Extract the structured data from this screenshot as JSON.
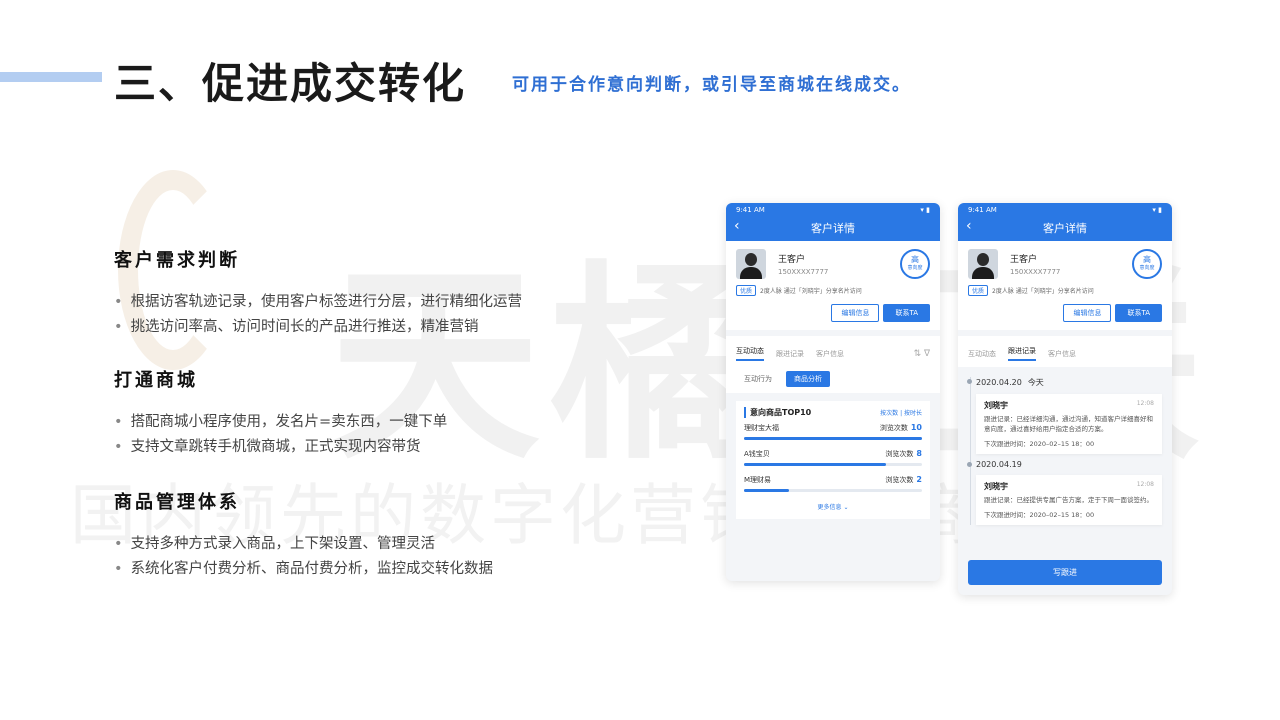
{
  "header": {
    "title": "三、促进成交转化",
    "subtitle": "可用于合作意向判断，或引导至商城在线成交。"
  },
  "watermark": {
    "big": "天橘互联",
    "line": "国内领先的数字化营销服务商"
  },
  "sections": [
    {
      "title": "客户需求判断",
      "bullets": [
        "根据访客轨迹记录，使用客户标签进行分层，进行精细化运营",
        "挑选访问率高、访问时间长的产品进行推送，精准营销"
      ]
    },
    {
      "title": "打通商城",
      "bullets": [
        "搭配商城小程序使用，发名片=卖东西，一键下单",
        "支持文章跳转手机微商城，正式实现内容带货"
      ]
    },
    {
      "title": "商品管理体系",
      "bullets": [
        "支持多种方式录入商品，上下架设置、管理灵活",
        "系统化客户付费分析、商品付费分析，监控成交转化数据"
      ]
    }
  ],
  "phone_a": {
    "status_time": "9:41 AM",
    "status_icons": "▾ ▮",
    "nav_title": "客户详情",
    "back_icon": "‹",
    "customer": {
      "name": "王客户",
      "phone": "150XXXX7777",
      "level": "高",
      "level_sub": "意向度",
      "tag": "优质",
      "source": "2度人脉  通过「刘晓宇」分享名片访问",
      "edit_label": "编辑信息",
      "contact_label": "联系TA"
    },
    "tabs": [
      "互动动态",
      "跟进记录",
      "客户信息"
    ],
    "tab_tools": "⇅  ∇",
    "segments": [
      "互动行为",
      "商品分析"
    ],
    "top": {
      "title": "意向商品TOP10",
      "sort": "按次数 | 按时长",
      "count_label": "浏览次数",
      "products": [
        {
          "name": "理财宝大福",
          "count": "10",
          "fill": 1.0
        },
        {
          "name": "A钱宝贝",
          "count": "8",
          "fill": 0.8
        },
        {
          "name": "M理财易",
          "count": "2",
          "fill": 0.25
        }
      ],
      "more": "更多信息 ⌄"
    }
  },
  "phone_b": {
    "status_time": "9:41 AM",
    "status_icons": "▾ ▮",
    "nav_title": "客户详情",
    "back_icon": "‹",
    "customer": {
      "name": "王客户",
      "phone": "150XXXX7777",
      "level": "高",
      "level_sub": "意向度",
      "tag": "优质",
      "source": "2度人脉  通过「刘晓宇」分享名片访问",
      "edit_label": "编辑信息",
      "contact_label": "联系TA"
    },
    "tabs": [
      "互动动态",
      "跟进记录",
      "客户信息"
    ],
    "timeline": [
      {
        "date": "2020.04.20",
        "today": "今天",
        "name": "刘晓宇",
        "time": "12:08",
        "text": "跟进记录：已经详细沟通，通过沟通，知道客户详细喜好和意向度，通过喜好给用户指定合适的方案。",
        "next": "下次跟进时间：2020–02–15 18：00"
      },
      {
        "date": "2020.04.19",
        "today": "",
        "name": "刘晓宇",
        "time": "12:08",
        "text": "跟进记录：已经提供专属广告方案，定于下周一面谈签约。",
        "next": "下次跟进时间：2020–02–15 18：00"
      }
    ],
    "write_label": "写跟进"
  }
}
